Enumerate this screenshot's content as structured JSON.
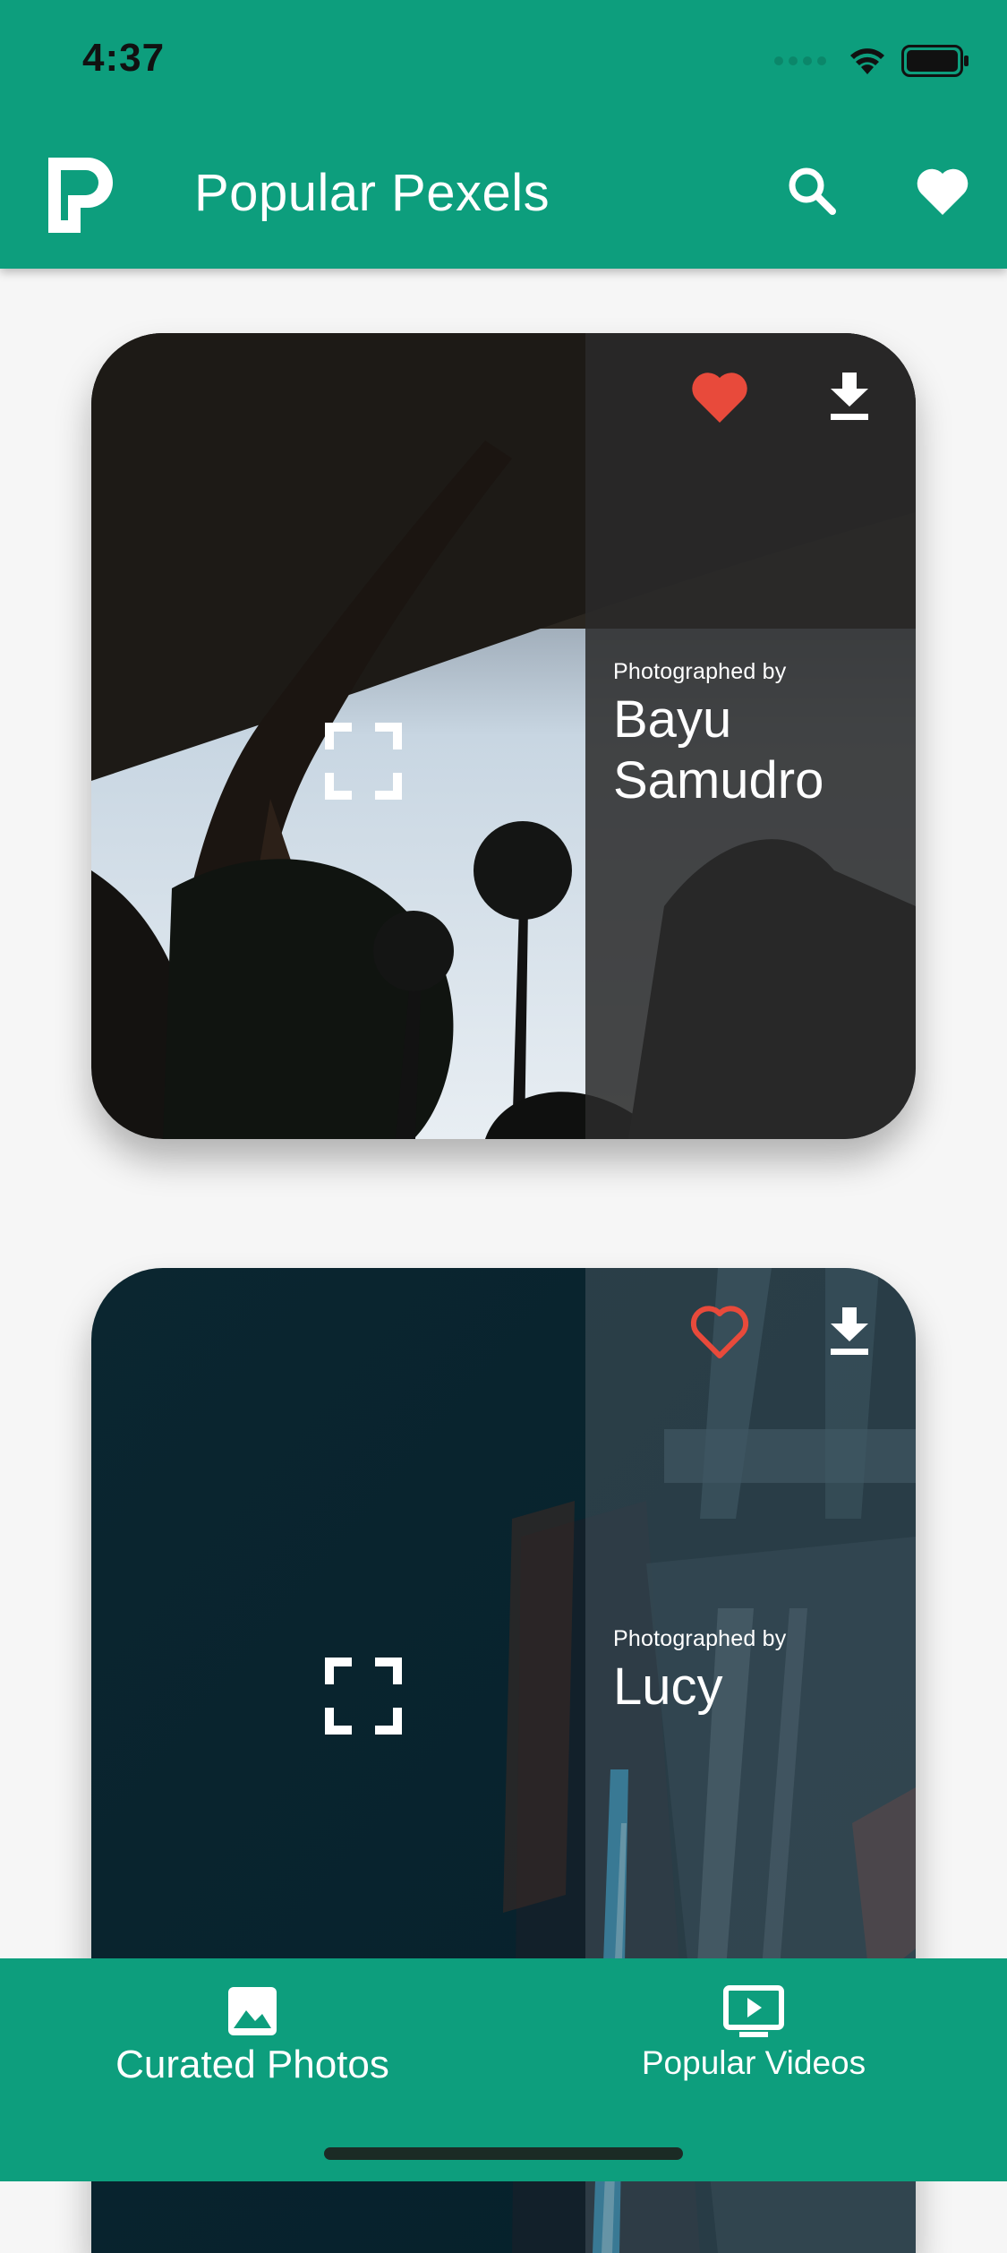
{
  "status_bar": {
    "time": "4:37"
  },
  "app_bar": {
    "title": "Popular Pexels",
    "logo_icon": "pexels-logo-icon",
    "search_icon": "search-icon",
    "favorites_icon": "heart-icon"
  },
  "cards": [
    {
      "photographed_by": "Photographed by",
      "photographer": "Bayu Samudro",
      "liked": true,
      "like_icon": "heart-filled-icon",
      "download_icon": "download-icon",
      "expand_icon": "fullscreen-icon"
    },
    {
      "photographed_by": "Photographed by",
      "photographer": "Lucy",
      "liked": false,
      "like_icon": "heart-outline-icon",
      "download_icon": "download-icon",
      "expand_icon": "fullscreen-icon"
    }
  ],
  "bottom_nav": {
    "items": [
      {
        "label": "Curated Photos",
        "icon": "image-icon"
      },
      {
        "label": "Popular Videos",
        "icon": "video-icon"
      }
    ]
  },
  "colors": {
    "primary": "#0d9e7d",
    "like_red": "#e84a3b",
    "background": "#f6f6f6"
  }
}
